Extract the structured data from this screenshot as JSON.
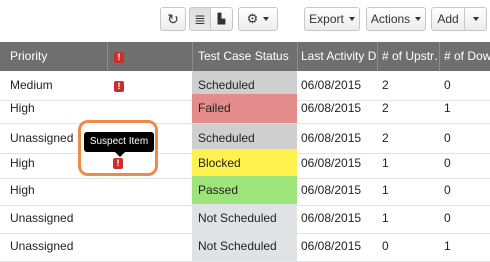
{
  "toolbar": {
    "refresh_icon": "refresh-icon",
    "list_icon": "list-view-icon",
    "doc_icon": "document-view-icon",
    "settings_icon": "gear-icon",
    "export_label": "Export",
    "actions_label": "Actions",
    "add_label": "Add",
    "refresh_glyph": "↻",
    "list_glyph": "≣",
    "doc_glyph": "▙",
    "gear_glyph": "⚙"
  },
  "columns": {
    "priority": "Priority",
    "suspect": "!",
    "status": "Test Case Status",
    "last_activity": "Last Activity Date",
    "upstream": "# of Upstr…",
    "downstream": "# of Down…"
  },
  "rows": [
    {
      "priority": "Medium",
      "suspect": "!",
      "status": "Scheduled",
      "status_color": "#cfcfcf",
      "date": "06/08/2015",
      "up": "2",
      "down": "0"
    },
    {
      "priority": "High",
      "suspect": "",
      "status": "Failed",
      "status_color": "#e48b8b",
      "date": "06/08/2015",
      "up": "2",
      "down": "1"
    },
    {
      "priority": "Unassigned",
      "suspect": "",
      "status": "Scheduled",
      "status_color": "#cfcfcf",
      "date": "06/08/2015",
      "up": "2",
      "down": "0"
    },
    {
      "priority": "High",
      "suspect": "!",
      "status": "Blocked",
      "status_color": "#fff24f",
      "date": "06/08/2015",
      "up": "1",
      "down": "0"
    },
    {
      "priority": "High",
      "suspect": "",
      "status": "Passed",
      "status_color": "#9de57b",
      "date": "06/08/2015",
      "up": "1",
      "down": "0"
    },
    {
      "priority": "Unassigned",
      "suspect": "",
      "status": "Not Scheduled",
      "status_color": "#dfe3e6",
      "date": "06/08/2015",
      "up": "1",
      "down": "0"
    },
    {
      "priority": "Unassigned",
      "suspect": "",
      "status": "Not Scheduled",
      "status_color": "#dfe3e6",
      "date": "06/08/2015",
      "up": "0",
      "down": "1"
    }
  ],
  "tooltip": {
    "text": "Suspect Item"
  }
}
